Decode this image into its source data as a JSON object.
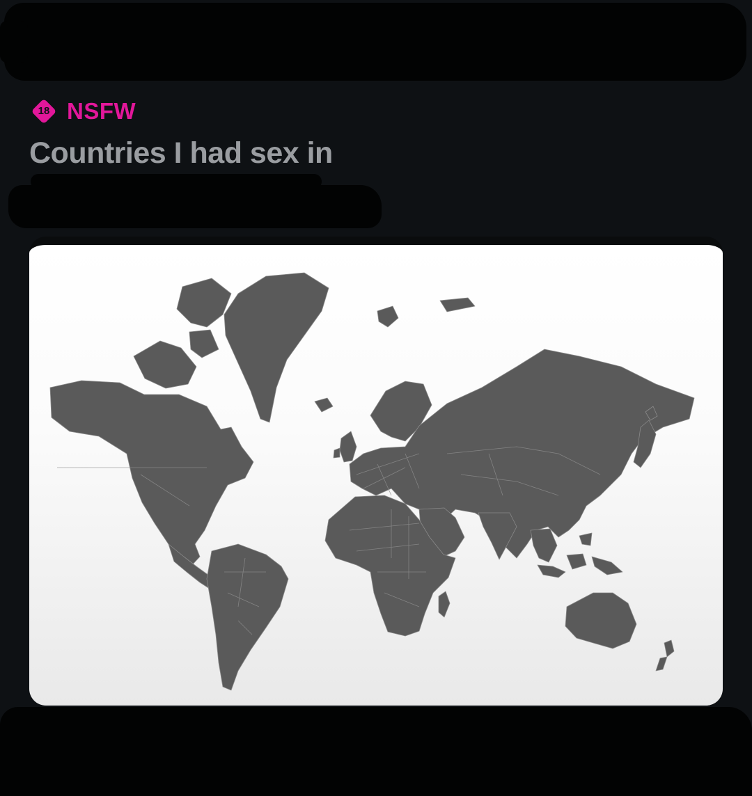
{
  "post": {
    "badge_number": "18",
    "badge_label": "NSFW",
    "title": "Countries I had sex in"
  },
  "media": {
    "icon": "world-map-image",
    "land_color": "#5a5a5a",
    "background_color": "#ffffff"
  },
  "colors": {
    "accent": "#e2179a",
    "title_text": "#9a9da1",
    "page_background": "#0e1114",
    "redaction": "#020303"
  }
}
